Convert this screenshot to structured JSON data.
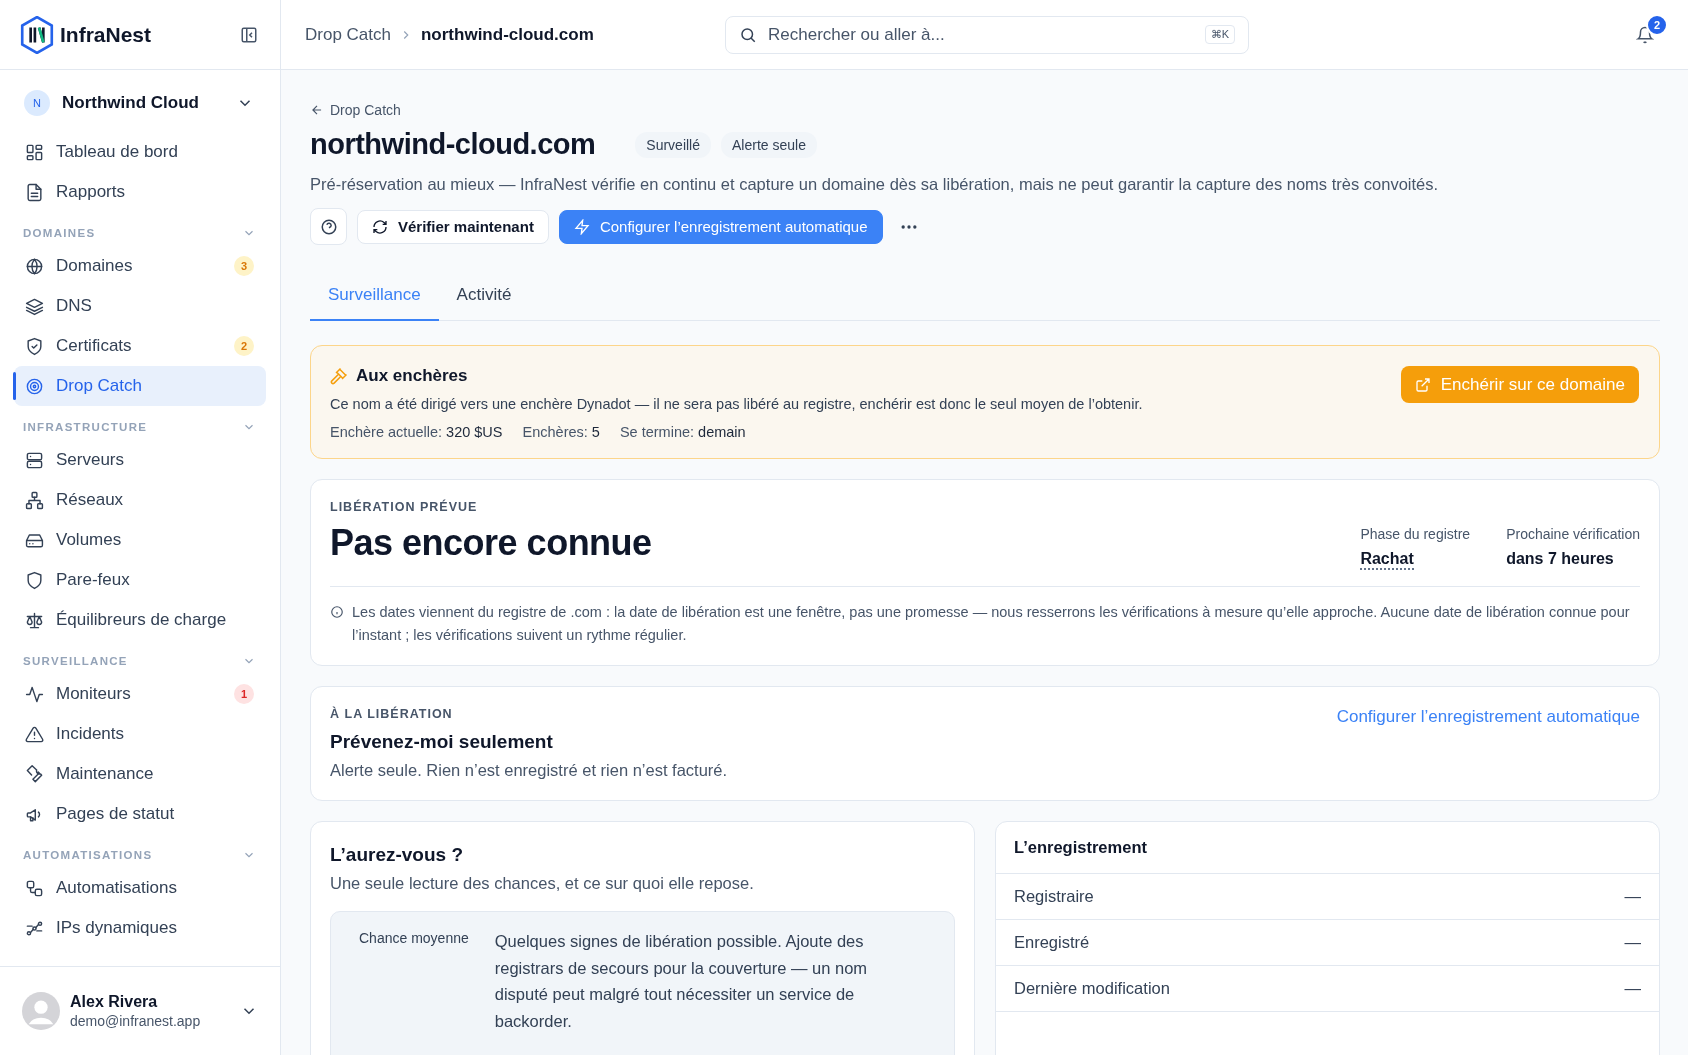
{
  "brand": {
    "name": "InfraNest"
  },
  "workspace": {
    "initial": "N",
    "name": "Northwind Cloud"
  },
  "nav": [
    {
      "items": [
        {
          "label": "Tableau de bord",
          "selected": false
        },
        {
          "label": "Rapports",
          "selected": false
        }
      ]
    },
    {
      "label": "DOMAINES",
      "items": [
        {
          "label": "Domaines",
          "selected": false,
          "badge": {
            "text": "3",
            "color": "#d97706"
          }
        },
        {
          "label": "DNS",
          "selected": false
        },
        {
          "label": "Certificats",
          "selected": false,
          "badge": {
            "text": "2",
            "color": "#d97706"
          }
        },
        {
          "label": "Drop Catch",
          "selected": true
        }
      ]
    },
    {
      "label": "INFRASTRUCTURE",
      "items": [
        {
          "label": "Serveurs",
          "selected": false
        },
        {
          "label": "Réseaux",
          "selected": false
        },
        {
          "label": "Volumes",
          "selected": false
        },
        {
          "label": "Pare-feux",
          "selected": false
        },
        {
          "label": "Équilibreurs de charge",
          "selected": false
        }
      ]
    },
    {
      "label": "SURVEILLANCE",
      "items": [
        {
          "label": "Moniteurs",
          "selected": false,
          "badge": {
            "text": "1",
            "color": "#dc2626"
          }
        },
        {
          "label": "Incidents",
          "selected": false
        },
        {
          "label": "Maintenance",
          "selected": false
        },
        {
          "label": "Pages de statut",
          "selected": false
        }
      ]
    },
    {
      "label": "AUTOMATISATIONS",
      "items": [
        {
          "label": "Automatisations",
          "selected": false
        },
        {
          "label": "IPs dynamiques",
          "selected": false
        }
      ]
    }
  ],
  "user": {
    "name": "Alex Rivera",
    "email": "demo@infranest.app"
  },
  "breadcrumb": [
    "Drop Catch",
    "northwind-cloud.com"
  ],
  "search": {
    "placeholder": "Rechercher ou aller à...",
    "shortcut": "⌘K"
  },
  "notifications": {
    "count": "2"
  },
  "page": {
    "back": "Drop Catch",
    "title": "northwind-cloud.com",
    "tags": [
      "Surveillé",
      "Alerte seule"
    ],
    "description": "Pré-réservation au mieux — InfraNest vérifie en continu et capture un domaine dès sa libération, mais ne peut garantir la capture des noms très convoités.",
    "actions": {
      "verify": "Vérifier maintenant",
      "configure": "Configurer l’enregistrement automatique"
    },
    "tabs": [
      {
        "label": "Surveillance",
        "selected": true
      },
      {
        "label": "Activité",
        "selected": false
      }
    ]
  },
  "auction": {
    "title": "Aux enchères",
    "text": "Ce nom a été dirigé vers une enchère Dynadot — il ne sera pas libéré au registre, enchérir est donc le seul moyen de l’obtenir.",
    "facts": [
      {
        "label": "Enchère actuelle:",
        "value": "320 $US"
      },
      {
        "label": "Enchères:",
        "value": "5"
      },
      {
        "label": "Se termine:",
        "value": "demain"
      }
    ],
    "button": "Enchérir sur ce domaine"
  },
  "release": {
    "eyebrow": "LIBÉRATION PRÉVUE",
    "value": "Pas encore connue",
    "meta": [
      {
        "label": "Phase du registre",
        "value": "Rachat",
        "kind": "term"
      },
      {
        "label": "Prochaine vérification",
        "value": "dans 7 heures",
        "kind": "plain"
      }
    ],
    "note": "Les dates viennent du registre de .com : la date de libération est une fenêtre, pas une promesse — nous resserrons les vérifications à mesure qu’elle approche. Aucune date de libération connue pour l’instant ; les vérifications suivent un rythme régulier."
  },
  "on_release": {
    "eyebrow": "À LA LIBÉRATION",
    "title": "Prévenez-moi seulement",
    "text": "Alerte seule. Rien n’est enregistré et rien n’est facturé.",
    "link": "Configurer l’enregistrement automatique"
  },
  "chances": {
    "title": "L’aurez-vous ?",
    "subtitle": "Une seule lecture des chances, et ce sur quoi elle repose.",
    "level_label": "Chance moyenne",
    "text": "Quelques signes de libération possible. Ajoute des registrars de secours pour la couverture — un nom disputé peut malgré tout nécessiter un service de backorder."
  },
  "registration": {
    "title": "L’enregistrement",
    "rows": [
      {
        "label": "Registraire",
        "value": "—"
      },
      {
        "label": "Enregistré",
        "value": "—"
      },
      {
        "label": "Dernière modification",
        "value": "—"
      }
    ]
  }
}
